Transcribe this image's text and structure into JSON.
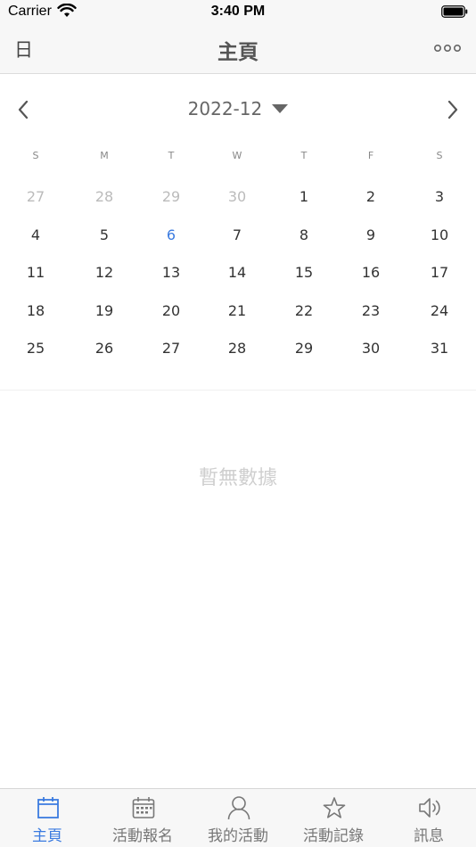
{
  "status_bar": {
    "carrier": "Carrier",
    "time": "3:40 PM"
  },
  "nav": {
    "left_label": "日",
    "title": "主頁"
  },
  "calendar": {
    "month_label": "2022-12",
    "weekdays": [
      "S",
      "M",
      "T",
      "W",
      "T",
      "F",
      "S"
    ],
    "weeks": [
      [
        "27",
        "28",
        "29",
        "30",
        "1",
        "2",
        "3"
      ],
      [
        "4",
        "5",
        "6",
        "7",
        "8",
        "9",
        "10"
      ],
      [
        "11",
        "12",
        "13",
        "14",
        "15",
        "16",
        "17"
      ],
      [
        "18",
        "19",
        "20",
        "21",
        "22",
        "23",
        "24"
      ],
      [
        "25",
        "26",
        "27",
        "28",
        "29",
        "30",
        "31"
      ]
    ],
    "muted": [
      [
        0,
        0
      ],
      [
        0,
        1
      ],
      [
        0,
        2
      ],
      [
        0,
        3
      ]
    ],
    "today": [
      1,
      2
    ]
  },
  "empty_text": "暫無數據",
  "tabs": [
    {
      "label": "主頁",
      "icon": "calendar-icon",
      "active": true
    },
    {
      "label": "活動報名",
      "icon": "calendar-grid-icon",
      "active": false
    },
    {
      "label": "我的活動",
      "icon": "person-icon",
      "active": false
    },
    {
      "label": "活動記錄",
      "icon": "star-icon",
      "active": false
    },
    {
      "label": "訊息",
      "icon": "speaker-icon",
      "active": false
    }
  ],
  "colors": {
    "accent": "#3b7be0",
    "muted": "#bbbbbb",
    "bar_bg": "#f7f7f7"
  }
}
